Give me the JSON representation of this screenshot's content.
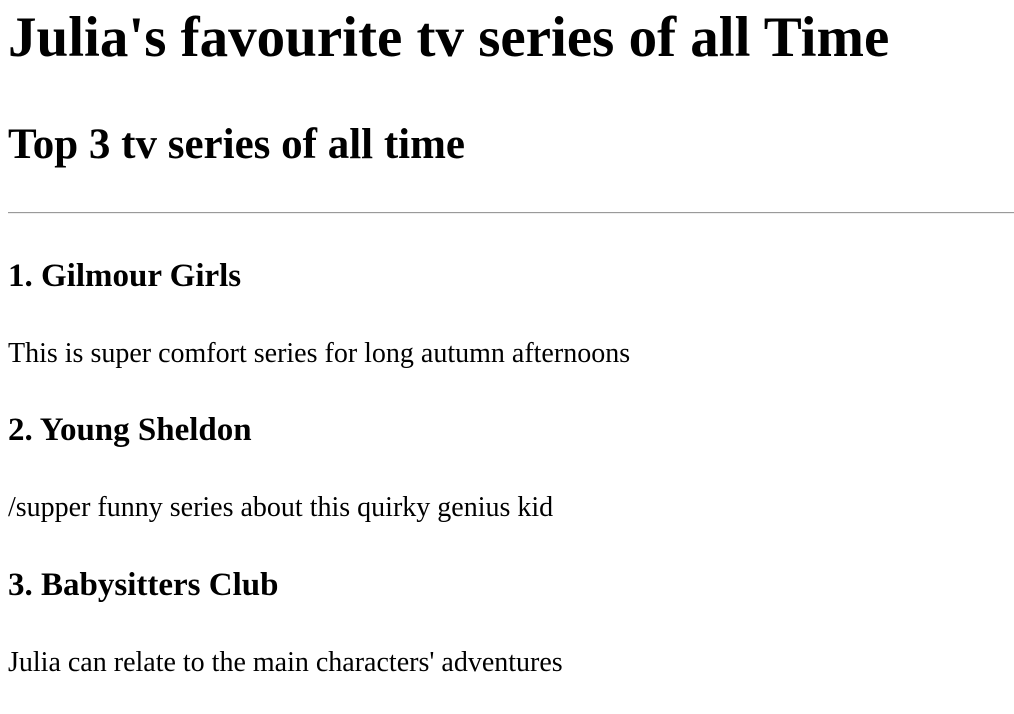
{
  "header": {
    "title": "Julia's favourite tv series of all Time",
    "subtitle": "Top 3 tv series of all time"
  },
  "series": [
    {
      "title": "1. Gilmour Girls",
      "description": "This is super comfort series for long autumn afternoons"
    },
    {
      "title": "2. Young Sheldon",
      "description": "/supper funny series about this quirky genius kid"
    },
    {
      "title": "3. Babysitters Club",
      "description": "Julia can relate to the main characters' adventures"
    }
  ]
}
